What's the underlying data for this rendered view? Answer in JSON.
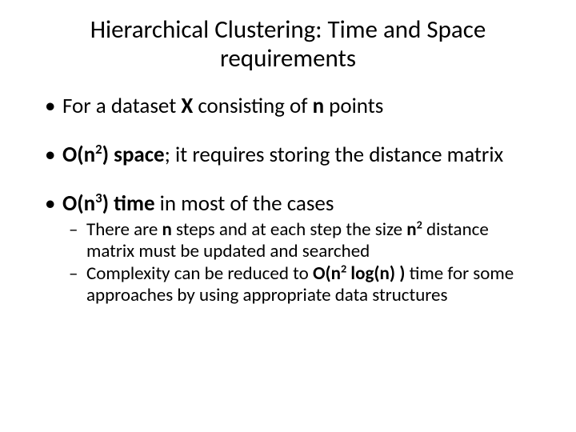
{
  "title": "Hierarchical Clustering:  Time and Space requirements",
  "bullets": [
    {
      "prefix": "For a dataset ",
      "X": "X",
      "mid": " consisting of ",
      "n": "n",
      "suffix": " points"
    },
    {
      "bigO_open": "O(n",
      "exp": "2",
      "bigO_close": ") space",
      "tail": "; it requires storing the distance matrix"
    },
    {
      "bigO_open": "O(n",
      "exp": "3",
      "bigO_close": ") time",
      "tail": " in most of the cases",
      "sub": [
        {
          "a": "There are ",
          "n": "n",
          "b": " steps and at each step the size ",
          "n2_base": "n",
          "n2_exp": "2",
          "c": " distance matrix must be updated and searched"
        },
        {
          "a": "Complexity can be reduced to ",
          "o_open": "O(n",
          "o_exp": "2",
          "o_mid": " log(n) )",
          "b": " time for some approaches by using appropriate data structures"
        }
      ]
    }
  ]
}
